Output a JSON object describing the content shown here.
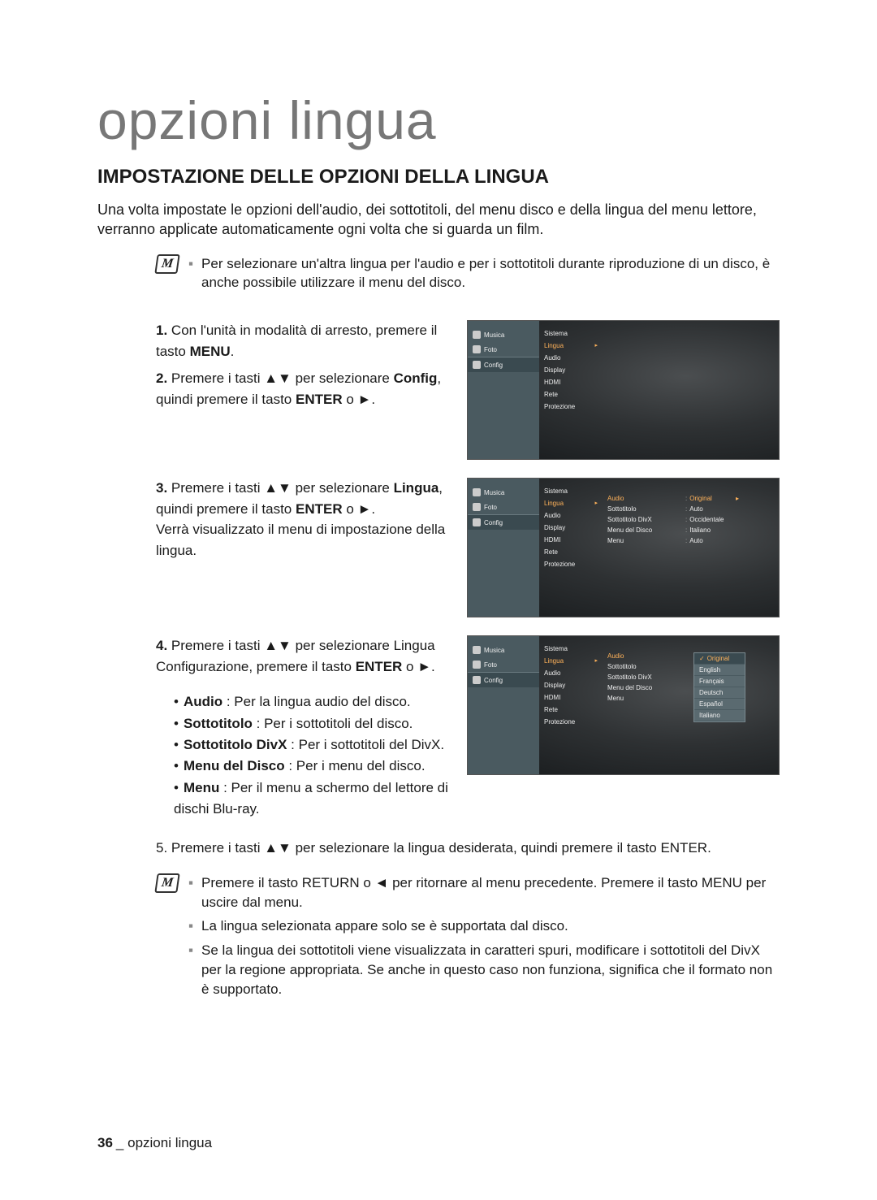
{
  "title": "opzioni lingua",
  "heading": "IMPOSTAZIONE DELLE OPZIONI DELLA LINGUA",
  "intro": "Una volta impostate le opzioni dell'audio, dei sottotitoli, del menu disco e della lingua del menu lettore, verranno applicate automaticamente ogni volta che si guarda un film.",
  "top_note": "Per selezionare un'altra lingua per l'audio e per i sottotitoli durante riproduzione di un disco, è anche possibile utilizzare il menu del disco.",
  "steps": {
    "s1_num": "1.",
    "s1_a": "Con l'unità in modalità di arresto, premere il tasto ",
    "s1_menu": "MENU",
    "s1_b": ".",
    "s2_num": "2.",
    "s2_a": "Premere i tasti ▲▼ per selezionare ",
    "s2_config": "Config",
    "s2_b": ", quindi premere il tasto ",
    "s2_enter": "ENTER",
    "s2_c": " o ►.",
    "s3_num": "3.",
    "s3_a": "Premere i tasti ▲▼ per selezionare ",
    "s3_lingua": "Lingua",
    "s3_b": ", quindi premere il tasto ",
    "s3_enter": "ENTER",
    "s3_c": " o ►.",
    "s3_d": "Verrà visualizzato il menu di impostazione della lingua.",
    "s4_num": "4.",
    "s4_a": "Premere i tasti ▲▼ per selezionare Lingua Configurazione, premere il tasto ",
    "s4_enter": "ENTER",
    "s4_b": " o ►.",
    "s4_items": {
      "audio_k": "Audio",
      "audio_v": " : Per la lingua audio del disco.",
      "sott_k": "Sottotitolo",
      "sott_v": " : Per i sottotitoli del disco.",
      "divx_k": "Sottotitolo DivX",
      "divx_v": " : Per i sottotitoli del DivX.",
      "mdisc_k": "Menu del Disco",
      "mdisc_v": " : Per i menu del disco.",
      "menu_k": "Menu",
      "menu_v": " : Per il menu a schermo del lettore di dischi Blu-ray."
    },
    "s5_num": "5.",
    "s5_a": "Premere i tasti ▲▼ per selezionare la lingua desiderata, quindi premere il tasto ",
    "s5_enter": "ENTER",
    "s5_b": "."
  },
  "bottom_notes": {
    "n1_a": "Premere il tasto ",
    "n1_return": "RETURN",
    "n1_b": " o ◄ per ritornare al menu precedente. Premere il tasto ",
    "n1_menu": "MENU",
    "n1_c": " per uscire dal menu.",
    "n2": "La lingua selezionata appare solo se è supportata dal disco.",
    "n3": "Se la lingua dei sottotitoli viene visualizzata in caratteri spuri, modificare i sottotitoli del DivX per la regione appropriata. Se anche in questo caso non funziona, significa che il formato non è supportato."
  },
  "footer": {
    "page": "36",
    "sep": "_",
    "label": " opzioni lingua"
  },
  "osd": {
    "left": {
      "musica": "Musica",
      "foto": "Foto",
      "config": "Config"
    },
    "col2": [
      "Sistema",
      "Lingua",
      "Audio",
      "Display",
      "HDMI",
      "Rete",
      "Protezione"
    ],
    "col3": [
      "Audio",
      "Sottotitolo",
      "Sottotitolo DivX",
      "Menu del Disco",
      "Menu"
    ],
    "col4": [
      "Original",
      "Auto",
      "Occidentale",
      "Italiano",
      "Auto"
    ],
    "dropdown": [
      "Original",
      "English",
      "Français",
      "Deutsch",
      "Español",
      "Italiano"
    ]
  }
}
